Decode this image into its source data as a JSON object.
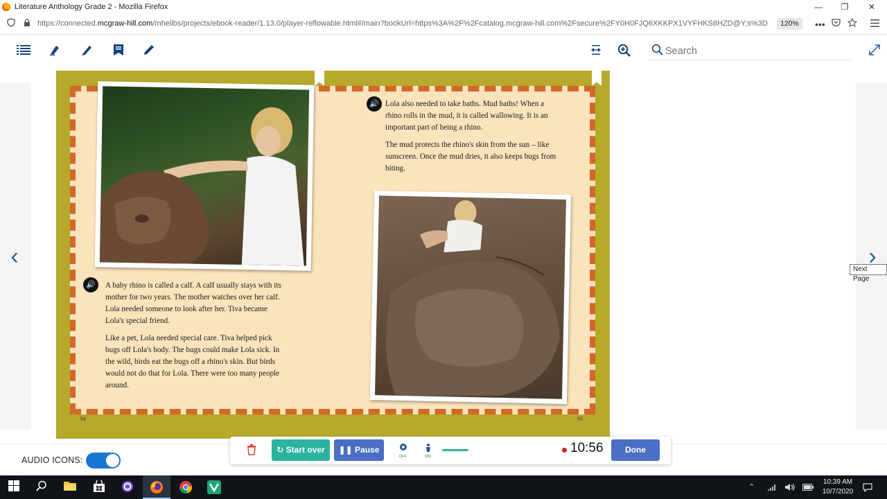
{
  "window": {
    "title": "Literature Anthology Grade 2 - Mozilla Firefox",
    "controls": [
      "—",
      "❐",
      "✕"
    ]
  },
  "browser": {
    "url_prefix": "https://connected.",
    "url_domain": "mcgraw-hill.com",
    "url_rest": "/mhelibs/projects/ebook-reader/1.13.0/player-reflowable.html#/main?bookUrl=https%3A%2F%2Fcatalog.mcgraw-hill.com%2Fsecure%2FY0H0FJQ6XKKPX1VYFHKS8HZD@Y;s%3D",
    "zoom": "120%"
  },
  "toolbar": {
    "icons": [
      "list-icon",
      "eraser-icon",
      "highlighter-icon",
      "note-icon",
      "pen-icon",
      "fit-width-icon",
      "zoom-in-icon",
      "fullscreen-icon"
    ],
    "search_placeholder": "Search"
  },
  "book": {
    "left_page_number": "94",
    "right_page_number": "95",
    "right_top_text": [
      "Lola also needed to take baths. Mud baths! When a rhino rolls in the mud, it is called wallowing. It is an important part of being a rhino.",
      "The mud protects the rhino's skin from the sun – like sunscreen. Once the mud dries, it also keeps bugs from biting."
    ],
    "left_bottom_text": [
      "A baby rhino is called a calf. A calf usually stays with its mother for two years. The mother watches over her calf. Lola needed someone to look after her. Tiva became Lola's special friend.",
      "Like a pet, Lola needed special care. Tiva helped pick bugs off Lola's body. The bugs could make Lola sick. In the wild, birds eat the bugs off a rhino's skin. But birds would not do that for Lola. There were too many people around."
    ],
    "colors": {
      "frame": "#b7a92a",
      "page": "#fbe3bc",
      "border": "#c74a22"
    }
  },
  "navigation": {
    "prev_label": "‹",
    "next_label": "›",
    "tooltip": "Next Page"
  },
  "audio": {
    "label": "AUDIO ICONS:",
    "toggle_on": true
  },
  "recorder": {
    "start_over_label": "Start over",
    "pause_label": "Pause",
    "mic_state": "OFF",
    "speaker_state": "ON",
    "time": "10:56",
    "done_label": "Done",
    "colors": {
      "start_over": "#2ab4a0",
      "pause": "#4a6fc4",
      "done": "#4a6fc4",
      "delete": "#e0443b"
    }
  },
  "taskbar": {
    "time": "10:39 AM",
    "date": "10/7/2020"
  }
}
